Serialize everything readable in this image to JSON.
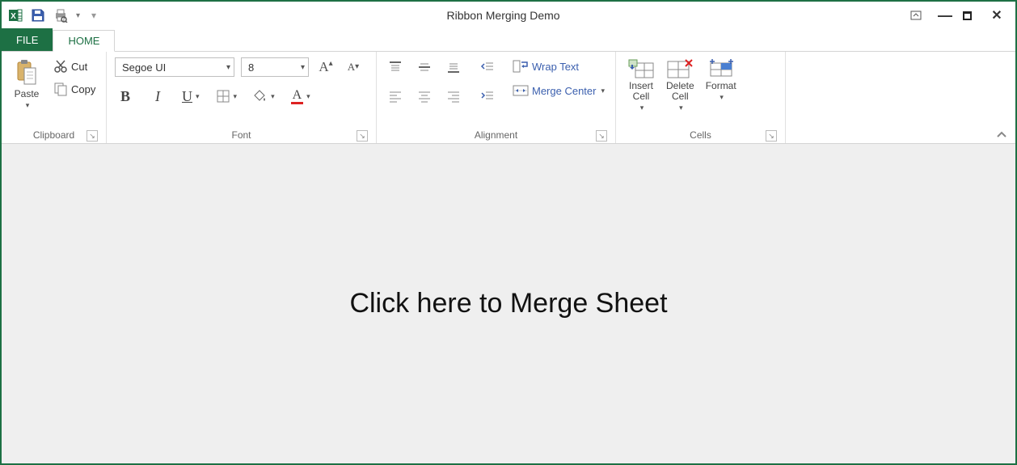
{
  "title": "Ribbon Merging Demo",
  "tabs": {
    "file": "FILE",
    "home": "HOME"
  },
  "clipboard": {
    "paste": "Paste",
    "cut": "Cut",
    "copy": "Copy",
    "group_label": "Clipboard"
  },
  "font": {
    "font_name": "Segoe UI",
    "font_size": "8",
    "group_label": "Font"
  },
  "alignment": {
    "wrap": "Wrap Text",
    "merge": "Merge  Center",
    "group_label": "Alignment"
  },
  "cells": {
    "insert": "Insert\nCell",
    "delete": "Delete\nCell",
    "format": "Format",
    "group_label": "Cells"
  },
  "content": {
    "message": "Click here to Merge Sheet"
  }
}
